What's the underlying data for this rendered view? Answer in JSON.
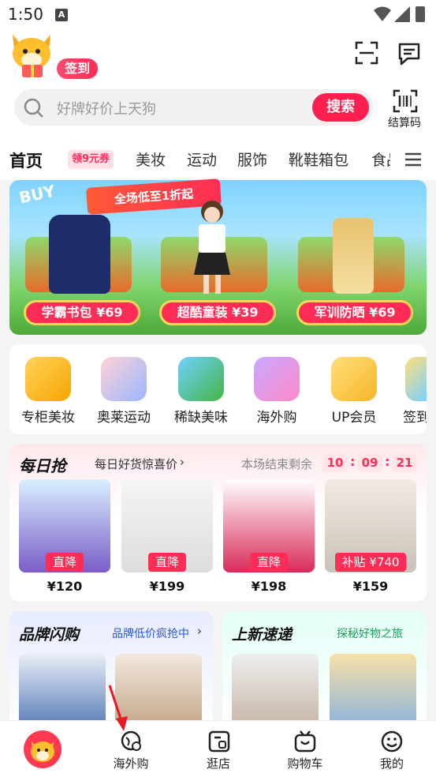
{
  "status_bar": {
    "time": "1:50",
    "app_indicator": "A"
  },
  "header": {
    "signin_label": "签到",
    "search_placeholder": "好牌好价上天狗",
    "search_button": "搜索",
    "barcode_label": "结算码"
  },
  "tabs": {
    "home": "首页",
    "coupon": "领9元券",
    "items": [
      "美妆",
      "运动",
      "服饰",
      "靴鞋箱包",
      "食品"
    ]
  },
  "banner": {
    "buy_text": "BUY",
    "sign_text": "全场低至1折起",
    "pills": [
      "学霸书包 ¥69",
      "超酷童装 ¥39",
      "军训防晒 ¥69"
    ]
  },
  "categories": [
    "专柜美妆",
    "奥莱运动",
    "稀缺美味",
    "海外购",
    "UP会员",
    "签到"
  ],
  "daily": {
    "title": "每日抢",
    "subtitle": "每日好货惊喜价",
    "ends_label": "本场结束剩余",
    "countdown": [
      "10",
      "09",
      "21"
    ],
    "deals": [
      {
        "tag": "直降",
        "price": "¥120"
      },
      {
        "tag": "直降",
        "price": "¥199"
      },
      {
        "tag": "直降",
        "price": "¥198"
      },
      {
        "tag": "补贴 ¥740",
        "price": "¥159"
      }
    ]
  },
  "brand": {
    "title": "品牌闪购",
    "subtitle": "品牌低价疯抢中"
  },
  "newin": {
    "title": "上新速递",
    "subtitle": "探秘好物之旅"
  },
  "bottom_nav": {
    "items": [
      "海外购",
      "逛店",
      "购物车",
      "我的"
    ]
  },
  "colors": {
    "accent": "#ff2d55",
    "search_button": "#ff1f4f"
  }
}
